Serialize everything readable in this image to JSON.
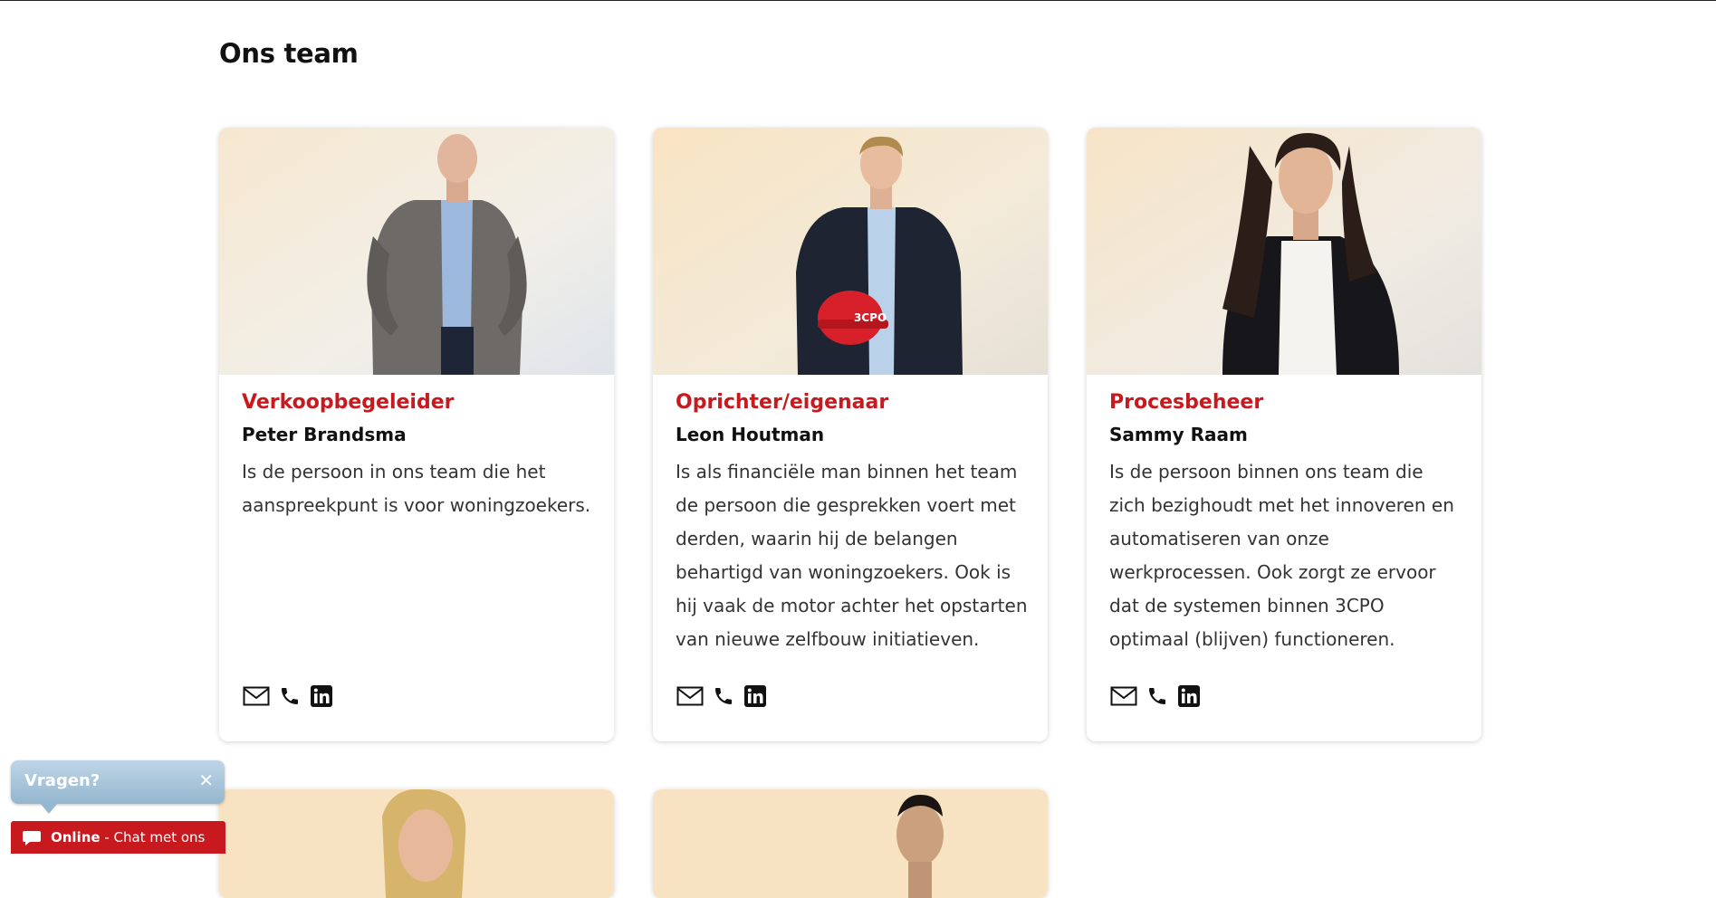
{
  "section": {
    "title": "Ons team"
  },
  "team": [
    {
      "role": "Verkoopbegeleider",
      "name": "Peter Brandsma",
      "description": "Is de persoon in ons team die het aanspreekpunt is voor woningzoekers.",
      "photo_alt": "Foto Peter Brandsma"
    },
    {
      "role": "Oprichter/eigenaar",
      "name": "Leon Houtman",
      "description": "Is als financiële man binnen het team de persoon die gesprekken voert met derden, waarin hij de belangen behartigd van woningzoekers. Ook is hij vaak de motor achter het opstarten van nieuwe zelfbouw initiatieven.",
      "photo_alt": "Foto Leon Houtman"
    },
    {
      "role": "Procesbeheer",
      "name": "Sammy Raam",
      "description": "Is de persoon binnen ons team die zich bezighoudt met het innoveren en automatiseren van onze werkprocessen. Ook zorgt ze ervoor dat de systemen binnen 3CPO optimaal (blijven) functioneren.",
      "photo_alt": "Foto Sammy Raam"
    }
  ],
  "contact_icons": [
    "mail-icon",
    "phone-icon",
    "linkedin-icon"
  ],
  "helmet_logo": "3CPO",
  "chat": {
    "bubble_label": "Vragen?",
    "close_label": "✕",
    "status": "Online",
    "action": " - Chat met ons"
  },
  "colors": {
    "accent": "#c8191e",
    "chat_bubble": "#a9c5da",
    "text": "#333333"
  }
}
